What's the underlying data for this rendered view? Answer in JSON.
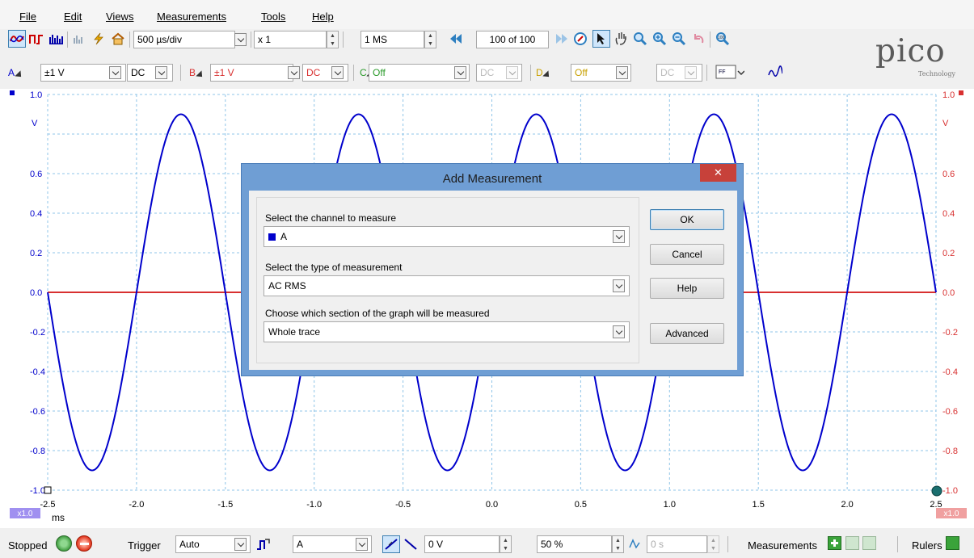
{
  "menu": [
    "File",
    "Edit",
    "Views",
    "Measurements",
    "Tools",
    "Help"
  ],
  "toolbar1": {
    "timebase": "500 µs/div",
    "zoom": "x 1",
    "samples": "1 MS",
    "buffer": "100 of 100"
  },
  "channels": {
    "a": {
      "letter": "A",
      "range": "±1 V",
      "coupling": "DC",
      "color": "#0000cc"
    },
    "b": {
      "letter": "B",
      "range": "±1 V",
      "coupling": "DC",
      "color": "#d83030"
    },
    "c": {
      "letter": "C",
      "range": "Off",
      "coupling": "DC",
      "color": "#2a9a2a"
    },
    "d": {
      "letter": "D",
      "range": "Off",
      "coupling": "DC",
      "color": "#c8a000"
    }
  },
  "logo": {
    "word": "pico",
    "sub": "Technology"
  },
  "graph": {
    "y_ticks": [
      "1.0",
      "0.6",
      "0.4",
      "0.2",
      "0.0",
      "-0.2",
      "-0.4",
      "-0.6",
      "-0.8",
      "-1.0"
    ],
    "y_unit": "V",
    "x_ticks": [
      "-2.5",
      "-2.0",
      "-1.5",
      "-1.0",
      "-0.5",
      "0.0",
      "0.5",
      "1.0",
      "1.5",
      "2.0",
      "2.5"
    ],
    "x_unit": "ms",
    "zoom_left": "x1.0",
    "zoom_right": "x1.0",
    "waveform": {
      "channel": "A",
      "shape": "sine",
      "amplitude_v": 0.9,
      "period_ms": 1.0,
      "phase_at_start": "0.0 V rising negative"
    },
    "channel_b_level_v": 0.0
  },
  "dialog": {
    "title": "Add Measurement",
    "close": "✕",
    "channel_label": "Select the channel to measure",
    "channel_value": "A",
    "type_label": "Select the type of measurement",
    "type_value": "AC RMS",
    "section_label": "Choose which section of the graph will be measured",
    "section_value": "Whole trace",
    "ok": "OK",
    "cancel": "Cancel",
    "help": "Help",
    "advanced": "Advanced"
  },
  "status": {
    "state": "Stopped",
    "trigger_label": "Trigger",
    "trigger_mode": "Auto",
    "trigger_channel": "A",
    "threshold": "0 V",
    "pretrigger": "50 %",
    "delay": "0 s",
    "measurements_label": "Measurements",
    "rulers_label": "Rulers"
  }
}
